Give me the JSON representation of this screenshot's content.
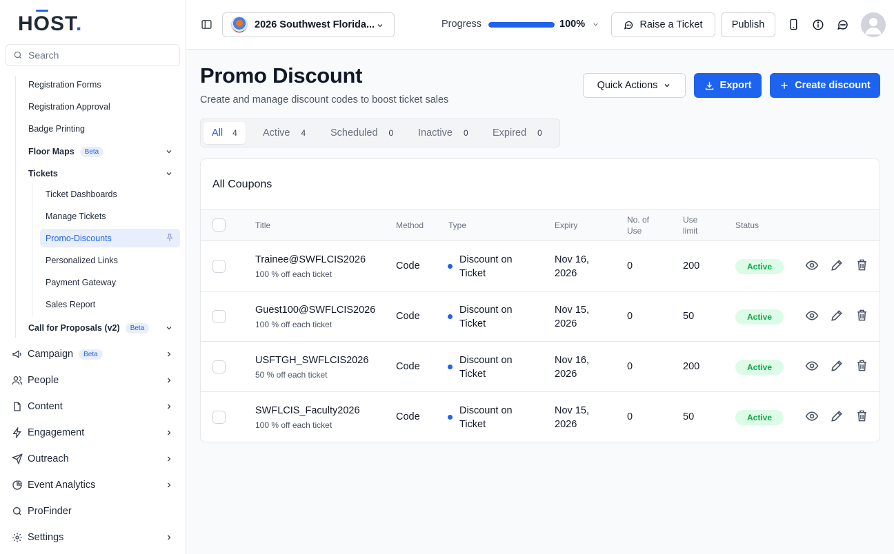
{
  "brand": {
    "logo_pre": "H",
    "logo_o": "O",
    "logo_post": "ST",
    "logo_dot": "."
  },
  "search": {
    "placeholder": "Search"
  },
  "sidebar": {
    "sub_items": [
      "Registration Forms",
      "Registration Approval",
      "Badge Printing"
    ],
    "floor_maps": {
      "label": "Floor Maps",
      "badge": "Beta"
    },
    "tickets": {
      "label": "Tickets"
    },
    "ticket_items": [
      "Ticket Dashboards",
      "Manage Tickets",
      "Promo-Discounts",
      "Personalized Links",
      "Payment Gateway",
      "Sales Report"
    ],
    "cfp": {
      "label": "Call for Proposals (v2)",
      "badge": "Beta"
    },
    "main_items": [
      {
        "label": "Campaign",
        "badge": "Beta",
        "icon": "megaphone-icon"
      },
      {
        "label": "People",
        "icon": "people-icon"
      },
      {
        "label": "Content",
        "icon": "file-icon"
      },
      {
        "label": "Engagement",
        "icon": "lightning-icon"
      },
      {
        "label": "Outreach",
        "icon": "send-icon"
      },
      {
        "label": "Event Analytics",
        "icon": "pie-chart-icon"
      },
      {
        "label": "ProFinder",
        "icon": "search-icon"
      },
      {
        "label": "Settings",
        "icon": "gear-icon"
      }
    ]
  },
  "topbar": {
    "event_name": "2026 Southwest Florida...",
    "progress_label": "Progress",
    "progress_value": "100%",
    "progress_fraction": 1.0,
    "raise_ticket": "Raise a Ticket",
    "publish": "Publish"
  },
  "page": {
    "title": "Promo Discount",
    "subtitle": "Create and manage discount codes to boost ticket sales",
    "quick_actions": "Quick Actions",
    "export": "Export",
    "create": "Create discount"
  },
  "tabs": [
    {
      "label": "All",
      "count": "4"
    },
    {
      "label": "Active",
      "count": "4"
    },
    {
      "label": "Scheduled",
      "count": "0"
    },
    {
      "label": "Inactive",
      "count": "0"
    },
    {
      "label": "Expired",
      "count": "0"
    }
  ],
  "table": {
    "card_title": "All Coupons",
    "headers": {
      "title": "Title",
      "method": "Method",
      "type": "Type",
      "expiry": "Expiry",
      "uses_1": "No. of",
      "uses_2": "Use",
      "limit_1": "Use",
      "limit_2": "limit",
      "status": "Status"
    },
    "rows": [
      {
        "title": "Trainee@SWFLCIS2026",
        "desc": "100 % off each ticket",
        "method": "Code",
        "type": "Discount on Ticket",
        "expiry": "Nov 16, 2026",
        "uses": "0",
        "limit": "200",
        "status": "Active"
      },
      {
        "title": "Guest100@SWFLCIS2026",
        "desc": "100 % off each ticket",
        "method": "Code",
        "type": "Discount on Ticket",
        "expiry": "Nov 15, 2026",
        "uses": "0",
        "limit": "50",
        "status": "Active"
      },
      {
        "title": "USFTGH_SWFLCIS2026",
        "desc": "50 % off each ticket",
        "method": "Code",
        "type": "Discount on Ticket",
        "expiry": "Nov 16, 2026",
        "uses": "0",
        "limit": "200",
        "status": "Active"
      },
      {
        "title": "SWFLCIS_Faculty2026",
        "desc": "100 % off each ticket",
        "method": "Code",
        "type": "Discount on Ticket",
        "expiry": "Nov 15, 2026",
        "uses": "0",
        "limit": "50",
        "status": "Active"
      }
    ]
  },
  "colors": {
    "accent": "#1d63ed",
    "active_bg": "#dcfce7",
    "active_text": "#16a34a"
  }
}
